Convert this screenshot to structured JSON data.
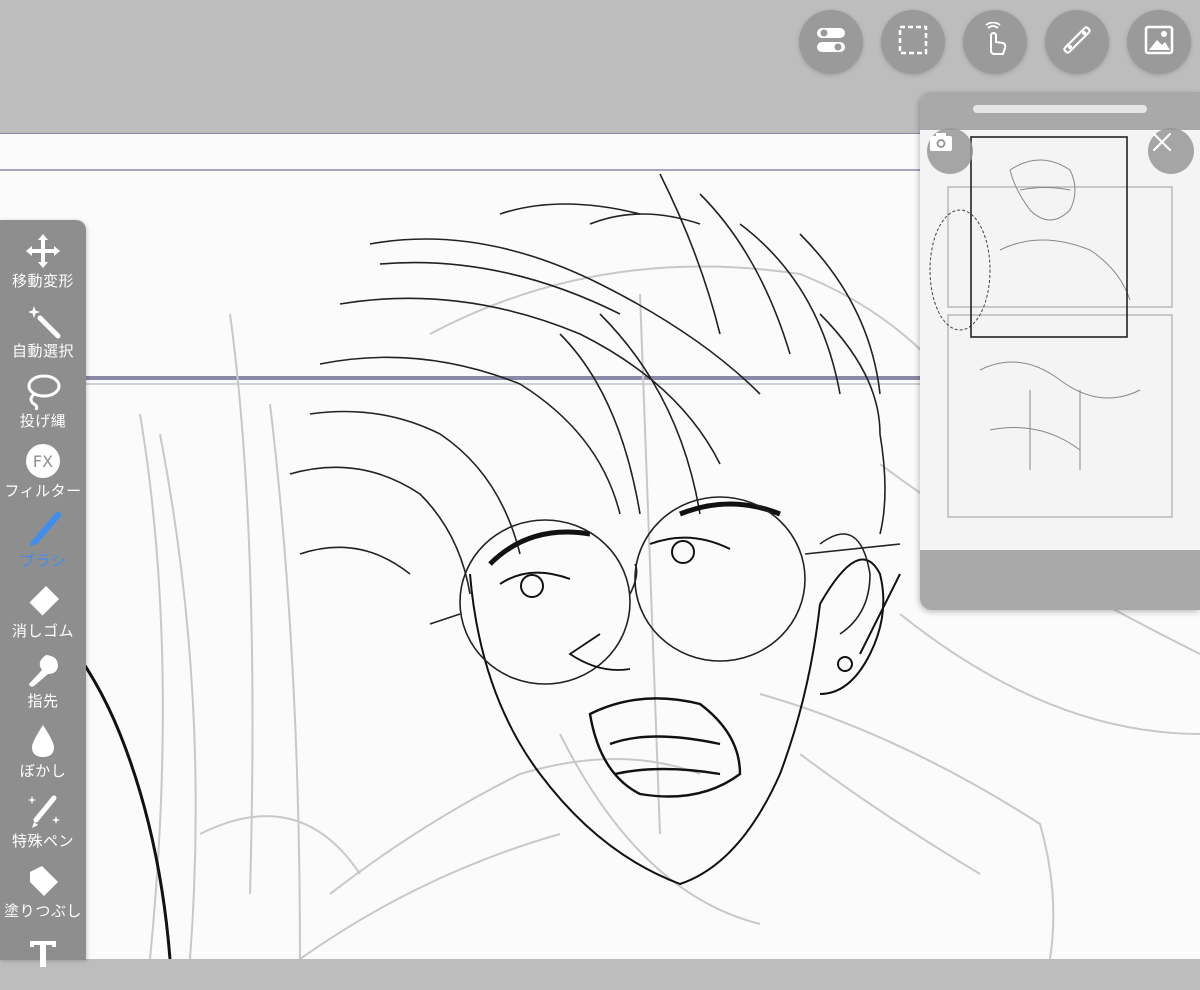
{
  "top_toolbar": {
    "buttons": [
      {
        "id": "toggle",
        "icon": "toggle-switch-icon"
      },
      {
        "id": "selection",
        "icon": "dashed-selection-icon"
      },
      {
        "id": "gesture",
        "icon": "hand-touch-icon"
      },
      {
        "id": "ruler",
        "icon": "ruler-icon"
      },
      {
        "id": "image",
        "icon": "image-icon"
      }
    ]
  },
  "tool_palette": {
    "tools": [
      {
        "label": "移動変形",
        "icon": "move-arrows-icon",
        "active": false
      },
      {
        "label": "自動選択",
        "icon": "magic-wand-icon",
        "active": false
      },
      {
        "label": "投げ縄",
        "icon": "lasso-icon",
        "active": false
      },
      {
        "label": "フィルター",
        "icon": "fx-filter-icon",
        "active": false
      },
      {
        "label": "ブラシ",
        "icon": "brush-icon",
        "active": true
      },
      {
        "label": "消しゴム",
        "icon": "eraser-icon",
        "active": false
      },
      {
        "label": "指先",
        "icon": "finger-smudge-icon",
        "active": false
      },
      {
        "label": "ぼかし",
        "icon": "blur-drop-icon",
        "active": false
      },
      {
        "label": "特殊ペン",
        "icon": "special-pen-icon",
        "active": false
      },
      {
        "label": "塗りつぶし",
        "icon": "fill-bucket-icon",
        "active": false
      },
      {
        "label": "",
        "icon": "text-tool-icon",
        "active": false
      }
    ],
    "active_color": "#3c8ef0"
  },
  "navigator": {
    "camera_icon": "camera-icon",
    "close_icon": "close-icon"
  },
  "colors": {
    "chrome": "#bdbdbd",
    "palette": "#8e8e8e",
    "canvas": "#fbfbfb",
    "accent": "#3c8ef0"
  }
}
